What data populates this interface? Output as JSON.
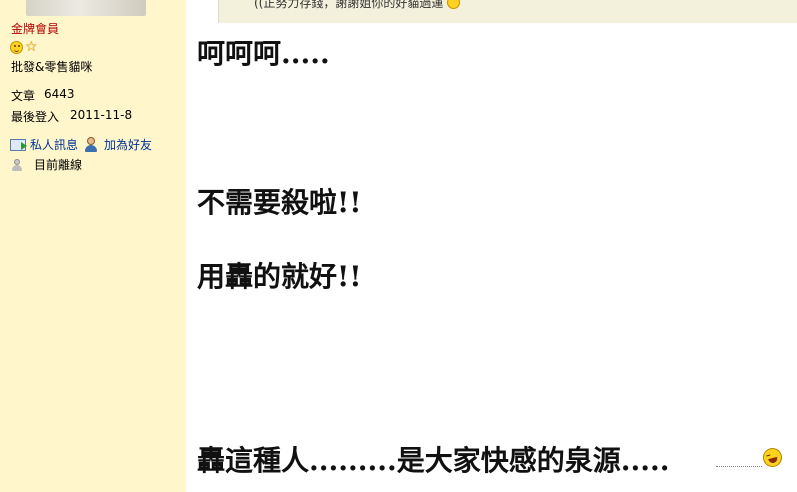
{
  "user": {
    "rank": "金牌會員",
    "custom_title": "批發&零售貓咪",
    "posts_label": "文章",
    "posts_value": "6443",
    "last_login_label": "最後登入",
    "last_login_value": "2011-11-8",
    "pm_label": "私人訊息",
    "add_friend_label": "加為好友",
    "status_label": "目前離線"
  },
  "quote": {
    "text": "((正努力存錢，謝謝姐你的好貓過運"
  },
  "post": {
    "lines": [
      "呵呵呵.....",
      "不需要殺啦!!",
      "用轟的就好!!",
      "轟這種人.........是大家快感的泉源....."
    ]
  },
  "colors": {
    "sidebar_bg": "#fff6cc",
    "rank_color": "#b30000",
    "link_color": "#003399",
    "quote_bg": "#f3f1dc"
  }
}
